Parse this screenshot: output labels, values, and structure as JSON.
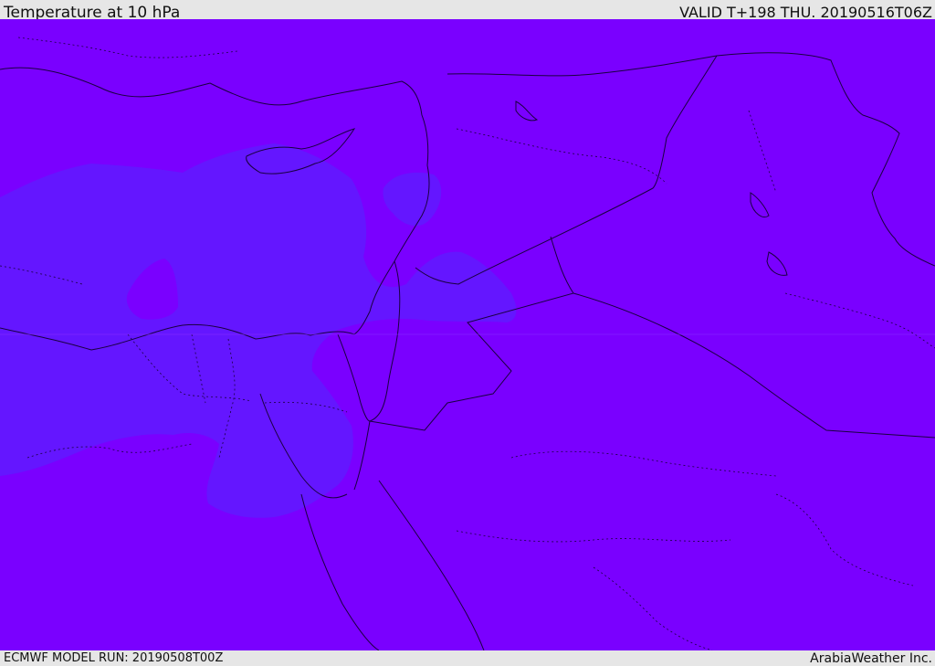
{
  "header": {
    "title": "Temperature at 10 hPa",
    "valid": "VALID T+198 THU. 20190516T06Z"
  },
  "footer": {
    "run": "ECMWF MODEL RUN: 20190508T00Z",
    "credit": "ArabiaWeather Inc."
  },
  "colors": {
    "background_field": "#7a00ff",
    "cooler_region": "#6416ff",
    "coastline": "#1a0040",
    "border": "#1a0040"
  }
}
